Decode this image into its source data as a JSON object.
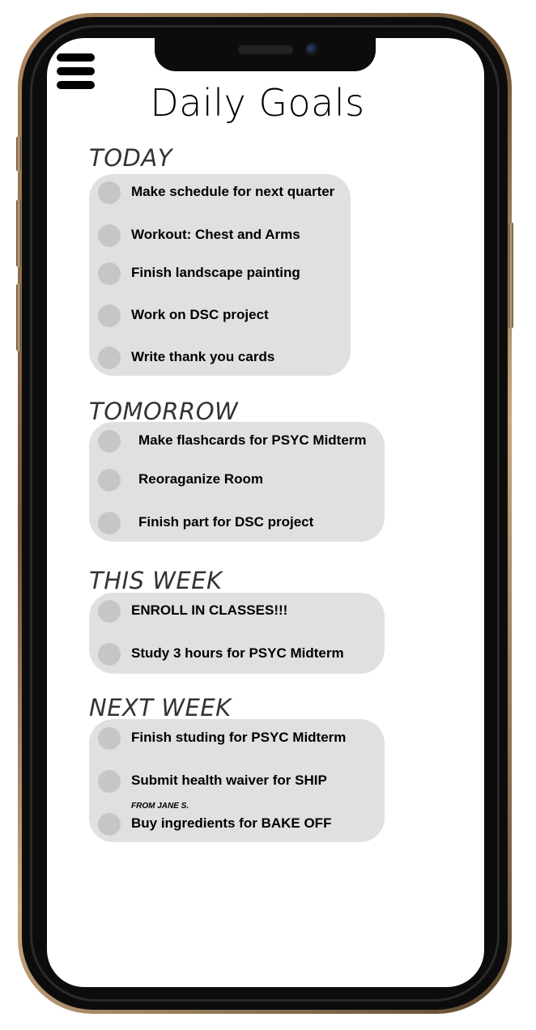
{
  "header": {
    "title": "Daily Goals",
    "menu_icon": "hamburger-menu-icon"
  },
  "sections": [
    {
      "heading": "TODAY",
      "tasks": [
        {
          "label": "Make schedule for next quarter",
          "done": false
        },
        {
          "label": "Workout: Chest and Arms",
          "done": false
        },
        {
          "label": "Finish landscape painting",
          "done": false
        },
        {
          "label": "Work on DSC project",
          "done": false
        },
        {
          "label": "Write thank you cards",
          "done": false
        }
      ]
    },
    {
      "heading": "TOMORROW",
      "tasks": [
        {
          "label": "Make flashcards for PSYC Midterm",
          "done": false
        },
        {
          "label": "Reoraganize Room",
          "done": false
        },
        {
          "label": "Finish part for DSC project",
          "done": false
        }
      ]
    },
    {
      "heading": "THIS WEEK",
      "tasks": [
        {
          "label": "ENROLL IN CLASSES!!!",
          "done": false
        },
        {
          "label": "Study 3 hours for PSYC Midterm",
          "done": false
        }
      ]
    },
    {
      "heading": "NEXT WEEK",
      "tasks": [
        {
          "label": "Finish studing for PSYC Midterm",
          "done": false
        },
        {
          "label": "Submit health waiver for SHIP",
          "done": false
        },
        {
          "label": "Buy ingredients for BAKE OFF",
          "note": "FROM JANE S.",
          "done": false
        }
      ]
    }
  ],
  "colors": {
    "card_background": "#e0e0e0",
    "checkbox_circle": "#c6c6c6",
    "phone_frame": "#b08a62"
  }
}
